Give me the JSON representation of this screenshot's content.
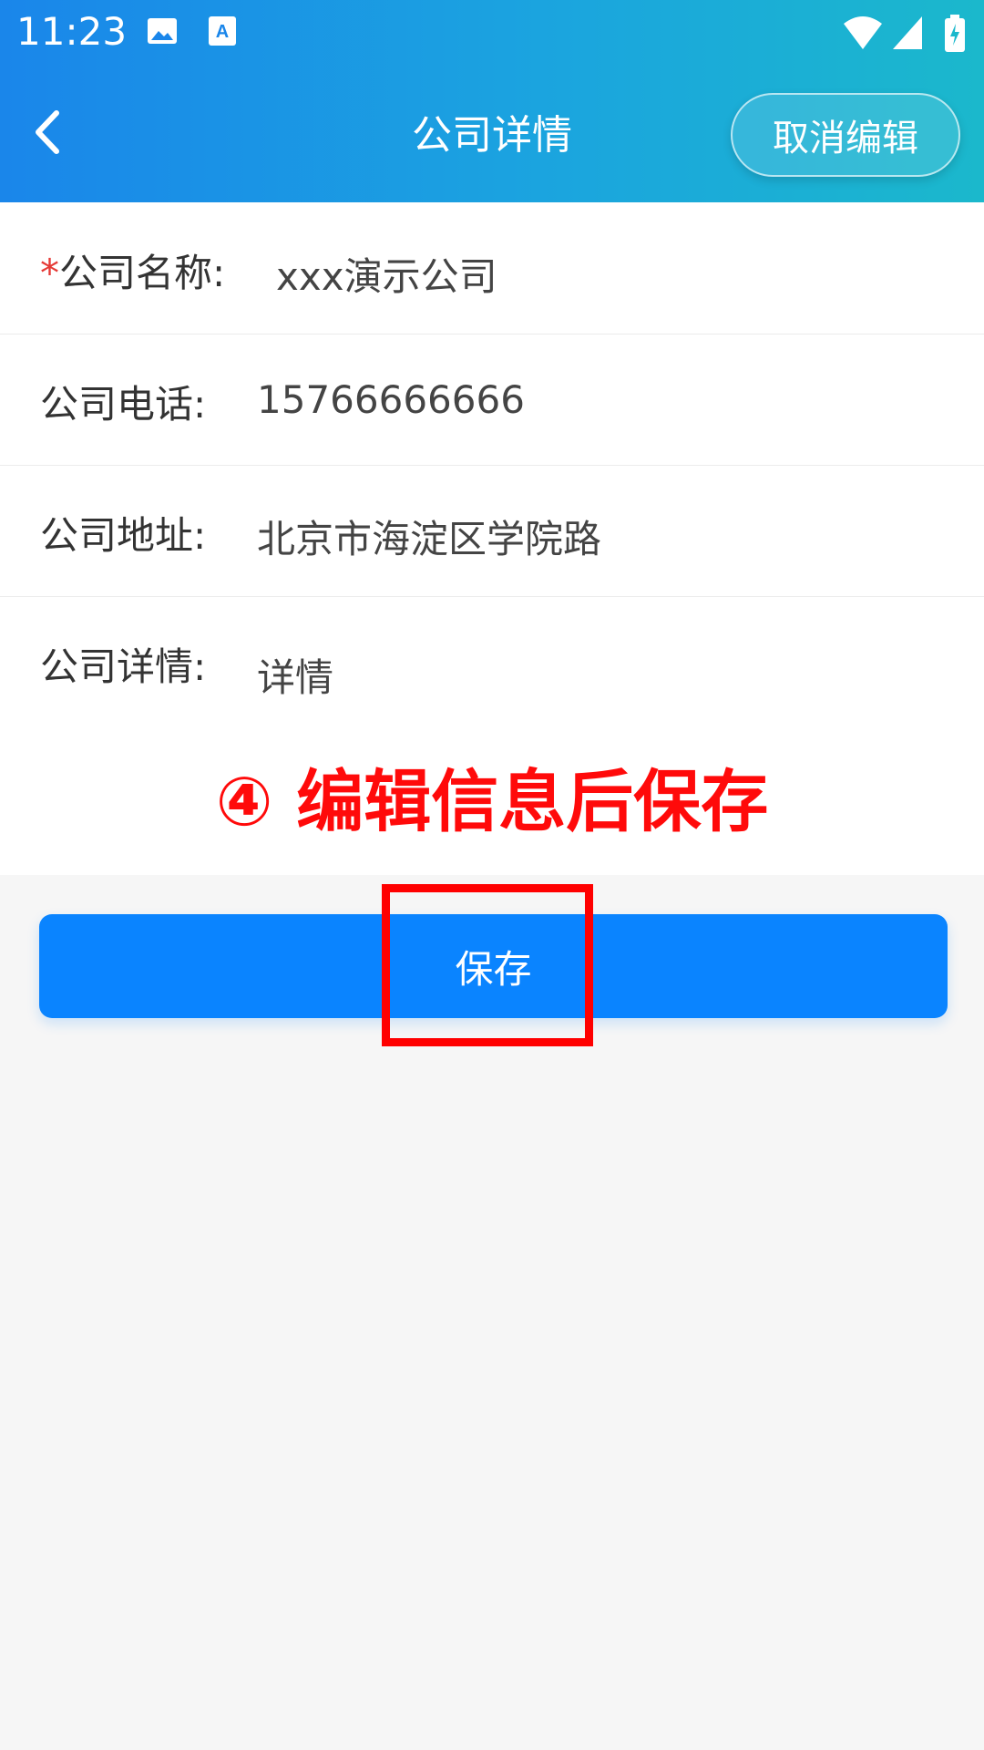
{
  "status_bar": {
    "time": "11:23",
    "icons": [
      "image-icon",
      "text-a-icon",
      "wifi-icon",
      "signal-icon",
      "battery-charging-icon"
    ]
  },
  "nav": {
    "title": "公司详情",
    "back_icon": "chevron-left-icon",
    "cancel_label": "取消编辑"
  },
  "form": {
    "fields": [
      {
        "required_mark": "*",
        "label": "公司名称:",
        "value": "xxx演示公司"
      },
      {
        "label": "公司电话:",
        "value": "15766666666"
      },
      {
        "label": "公司地址:",
        "value": "北京市海淀区学院路"
      },
      {
        "label": "公司详情:",
        "value": "详情"
      }
    ]
  },
  "annotation": "④ 编辑信息后保存",
  "save_label": "保存",
  "colors": {
    "header_gradient_start": "#1a86ea",
    "header_gradient_end": "#1bb8cc",
    "primary": "#0a84ff",
    "required": "#e53935",
    "annotation": "#ff0a0a"
  }
}
